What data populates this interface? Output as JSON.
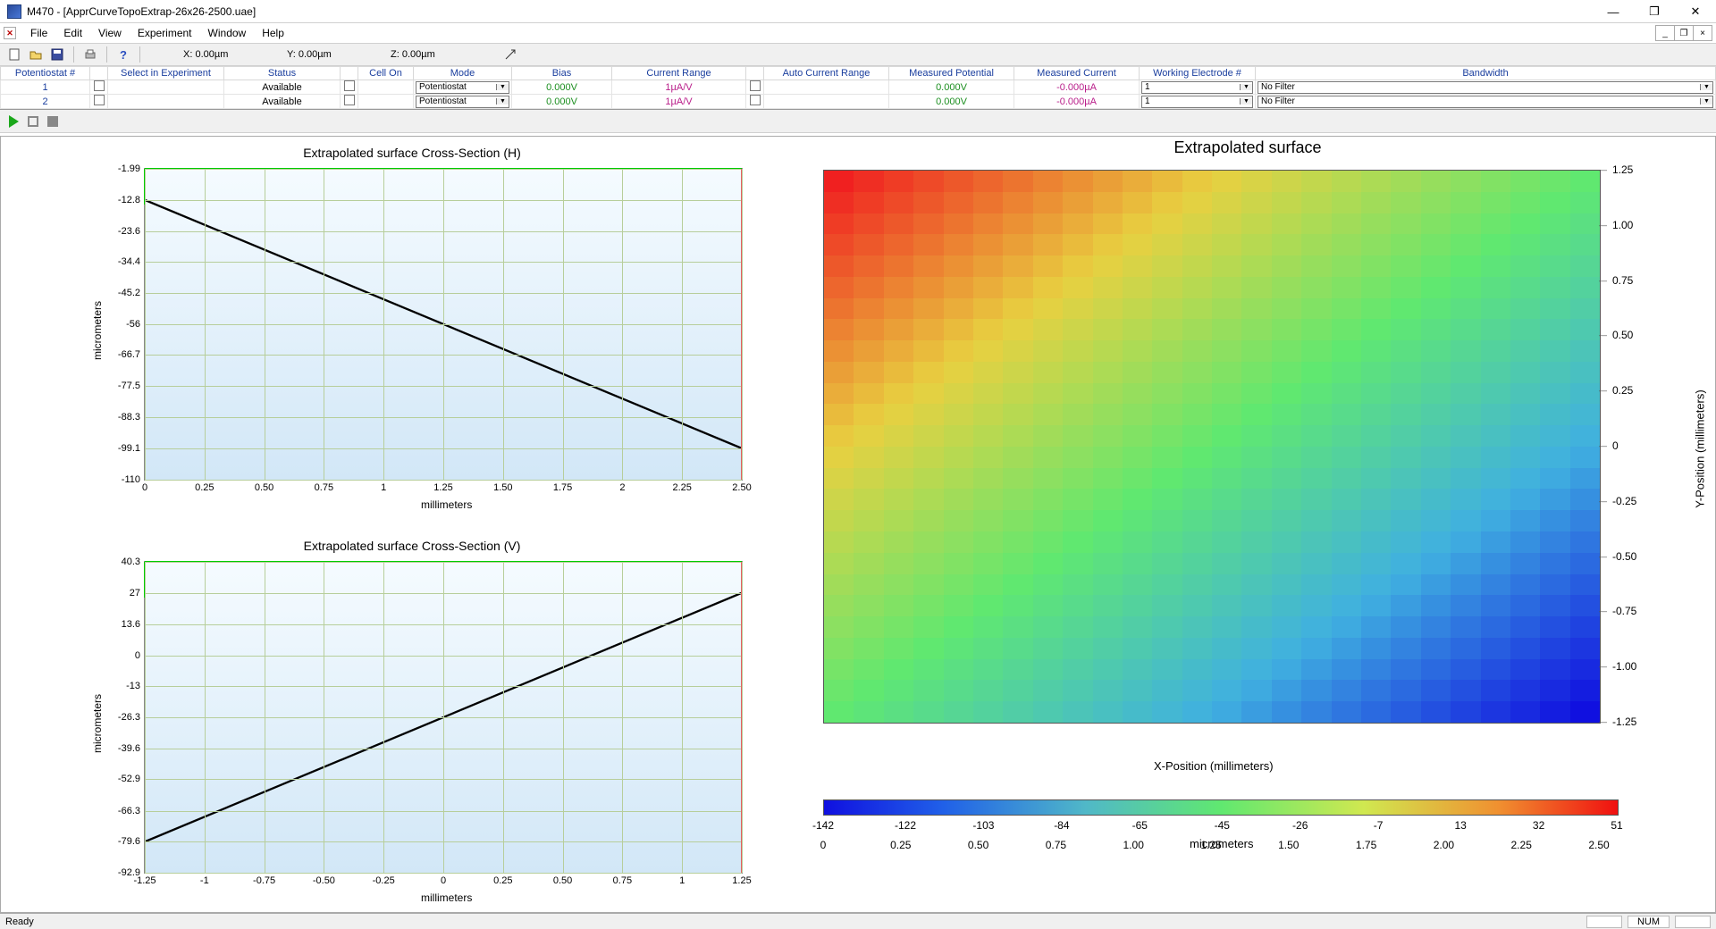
{
  "window": {
    "title": "M470 - [ApprCurveTopoExtrap-26x26-2500.uae]"
  },
  "menu": {
    "items": [
      "File",
      "Edit",
      "View",
      "Experiment",
      "Window",
      "Help"
    ]
  },
  "coords": {
    "x": "X:  0.00µm",
    "y": "Y:  0.00µm",
    "z": "Z:  0.00µm"
  },
  "dataHeaders": [
    "Potentiostat #",
    "",
    "Select in Experiment",
    "Status",
    "",
    "Cell On",
    "Mode",
    "Bias",
    "Current Range",
    "",
    "Auto Current Range",
    "Measured Potential",
    "Measured Current",
    "Working Electrode #",
    "Bandwidth"
  ],
  "dataRows": [
    {
      "num": "1",
      "sel": "",
      "status": "Available",
      "cell": "",
      "mode": "Potentiostat",
      "bias": "0.000V",
      "crange": "1µA/V",
      "auto": "",
      "mp": "0.000V",
      "mc": "-0.000µA",
      "we": "1",
      "bw": "No Filter"
    },
    {
      "num": "2",
      "sel": "",
      "status": "Available",
      "cell": "",
      "mode": "Potentiostat",
      "bias": "0.000V",
      "crange": "1µA/V",
      "auto": "",
      "mp": "0.000V",
      "mc": "-0.000µA",
      "we": "1",
      "bw": "No Filter"
    }
  ],
  "status": {
    "ready": "Ready",
    "num": "NUM"
  },
  "chart_data": [
    {
      "type": "line",
      "title": "Extrapolated surface Cross-Section (H)",
      "xlabel": "millimeters",
      "ylabel": "micrometers",
      "x_ticks": [
        0,
        0.25,
        0.5,
        0.75,
        1.0,
        1.25,
        1.5,
        1.75,
        2.0,
        2.25,
        2.5
      ],
      "y_ticks": [
        -1.99,
        -12.8,
        -23.6,
        -34.4,
        -45.2,
        -56,
        -66.7,
        -77.5,
        -88.3,
        -99.1,
        -110
      ],
      "xlim": [
        0,
        2.5
      ],
      "ylim": [
        -110,
        -1.99
      ],
      "data": {
        "x": [
          0,
          2.5
        ],
        "y": [
          -12.8,
          -99.1
        ]
      }
    },
    {
      "type": "line",
      "title": "Extrapolated surface Cross-Section (V)",
      "xlabel": "millimeters",
      "ylabel": "micrometers",
      "x_ticks": [
        -1.25,
        -1.0,
        -0.75,
        -0.5,
        -0.25,
        0,
        0.25,
        0.5,
        0.75,
        1.0,
        1.25
      ],
      "y_ticks": [
        40.3,
        27,
        13.6,
        0,
        -13,
        -26.3,
        -39.6,
        -52.9,
        -66.3,
        -79.6,
        -92.9
      ],
      "xlim": [
        -1.25,
        1.25
      ],
      "ylim": [
        -92.9,
        40.3
      ],
      "data": {
        "x": [
          -1.25,
          1.25
        ],
        "y": [
          -79.6,
          27
        ]
      }
    },
    {
      "type": "heatmap",
      "title": "Extrapolated surface",
      "xlabel": "X-Position (millimeters)",
      "ylabel": "Y-Position (millimeters)",
      "colorbar_label": "micrometers",
      "x_ticks": [
        0,
        0.25,
        0.5,
        0.75,
        1.0,
        1.25,
        1.5,
        1.75,
        2.0,
        2.25,
        2.5
      ],
      "y_ticks": [
        1.25,
        1.0,
        0.75,
        0.5,
        0.25,
        0,
        -0.25,
        -0.5,
        -0.75,
        -1.0,
        -1.25
      ],
      "xlim": [
        0,
        2.5
      ],
      "ylim": [
        -1.25,
        1.25
      ],
      "zlim": [
        -142,
        51
      ],
      "grid": [
        26,
        26
      ],
      "description": "planar gradient: z ≈ 51 at (x=0,y=1.25) to z ≈ -142 at (x=2.5,y=-1.25)",
      "colorbar_ticks": [
        -142,
        -122,
        -103,
        -84,
        -65,
        -45,
        -26,
        -7,
        13,
        32,
        51
      ]
    }
  ]
}
